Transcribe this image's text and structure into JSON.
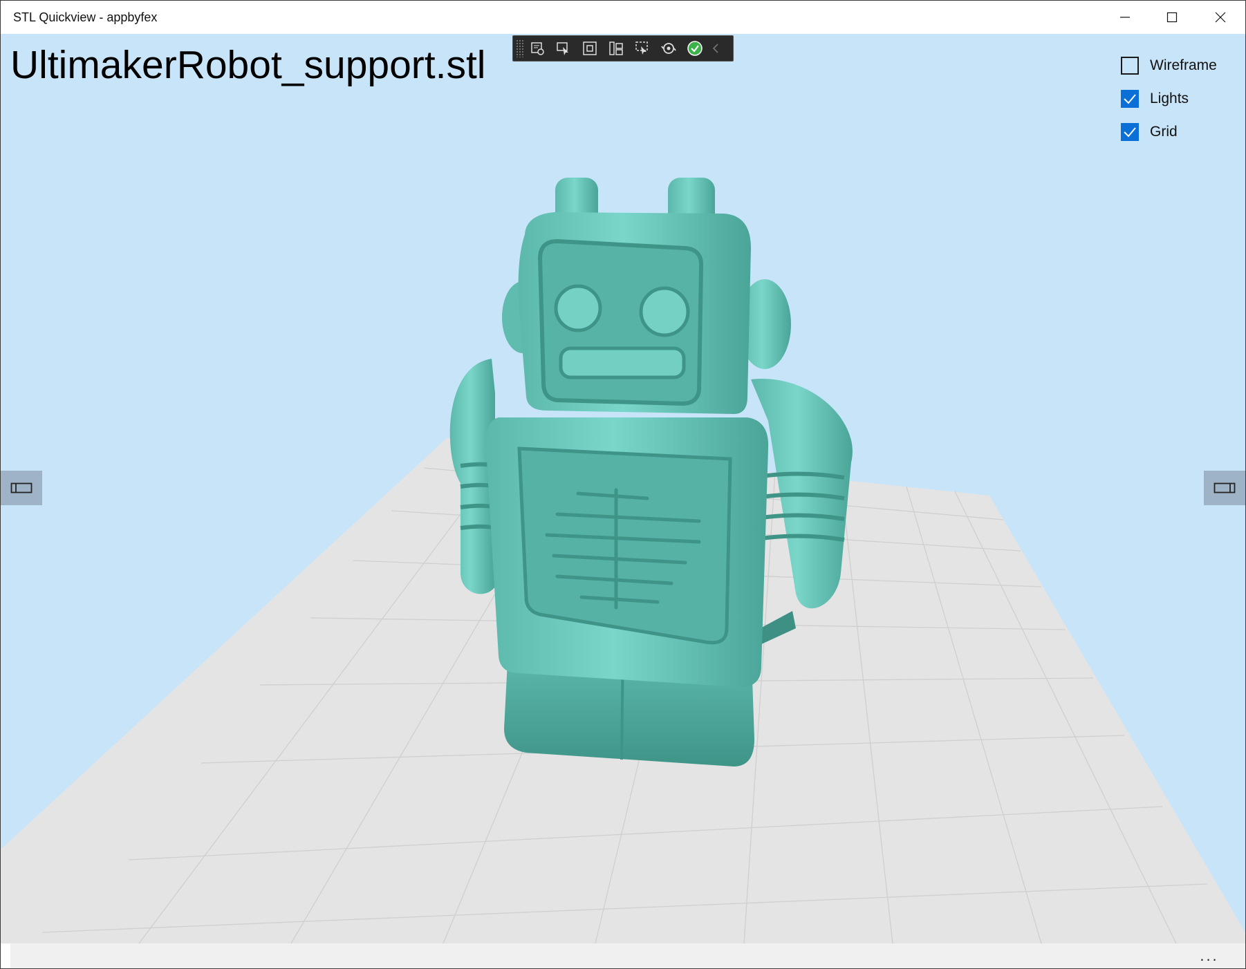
{
  "window": {
    "title": "STL Quickview - appbyfex",
    "controls": [
      "minimize-icon",
      "maximize-icon",
      "close-icon"
    ]
  },
  "viewer": {
    "filename": "UltimakerRobot_support.stl",
    "background_color": "#c8e4f8",
    "model_color": "#6cc9bc",
    "grid_color": "#e4e4e4"
  },
  "toolbar": {
    "buttons": [
      "live-visual-tree-icon",
      "select-element-icon",
      "display-layout-adorners-icon",
      "track-focused-element-icon",
      "preview-selection-icon",
      "hot-reload-icon",
      "status-ok-icon"
    ],
    "collapse_icon": "chevron-left-icon"
  },
  "options": [
    {
      "label": "Wireframe",
      "checked": false
    },
    {
      "label": "Lights",
      "checked": true
    },
    {
      "label": "Grid",
      "checked": true
    }
  ],
  "appbar": {
    "more_label": "..."
  },
  "colors": {
    "accent": "#0a6fd6",
    "toolbar_bg": "#2a2a2a",
    "side_tab_bg": "#9eb3c6"
  }
}
